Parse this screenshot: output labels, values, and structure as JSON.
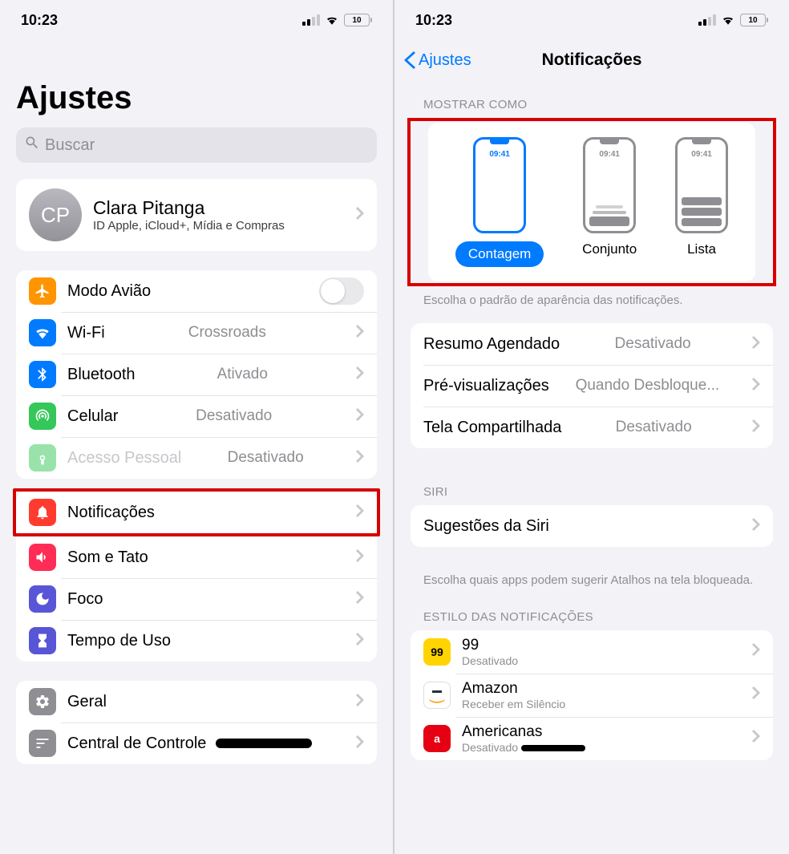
{
  "status": {
    "time": "10:23",
    "battery": "10"
  },
  "left": {
    "title": "Ajustes",
    "search_placeholder": "Buscar",
    "profile": {
      "initials": "CP",
      "name": "Clara Pitanga",
      "sub": "ID Apple, iCloud+, Mídia e Compras"
    },
    "g1": {
      "airplane": "Modo Avião",
      "wifi": "Wi-Fi",
      "wifi_val": "Crossroads",
      "bt": "Bluetooth",
      "bt_val": "Ativado",
      "cell": "Celular",
      "cell_val": "Desativado",
      "hotspot": "Acesso Pessoal",
      "hotspot_val": "Desativado"
    },
    "g2": {
      "notif": "Notificações",
      "sound": "Som e Tato",
      "focus": "Foco",
      "screentime": "Tempo de Uso"
    },
    "g3": {
      "general": "Geral",
      "control": "Central de Controle"
    }
  },
  "right": {
    "back": "Ajustes",
    "title": "Notificações",
    "show_as_header": "MOSTRAR COMO",
    "mock_time": "09:41",
    "opt_count": "Contagem",
    "opt_stack": "Conjunto",
    "opt_list": "Lista",
    "show_as_footer": "Escolha o padrão de aparência das notificações.",
    "scheduled": "Resumo Agendado",
    "scheduled_val": "Desativado",
    "previews": "Pré-visualizações",
    "previews_val": "Quando Desbloque...",
    "screenshare": "Tela Compartilhada",
    "screenshare_val": "Desativado",
    "siri_header": "SIRI",
    "siri_sugg": "Sugestões da Siri",
    "siri_footer": "Escolha quais apps podem sugerir Atalhos na tela bloqueada.",
    "style_header": "ESTILO DAS NOTIFICAÇÕES",
    "apps": [
      {
        "name": "99",
        "sub": "Desativado",
        "bg": "#ffd400",
        "fg": "#000",
        "badge": "99"
      },
      {
        "name": "Amazon",
        "sub": "Receber em Silêncio",
        "bg": "#fff",
        "fg": "#000",
        "badge": ""
      },
      {
        "name": "Americanas",
        "sub": "Desativado",
        "bg": "#e60014",
        "fg": "#fff",
        "badge": "a"
      }
    ]
  }
}
